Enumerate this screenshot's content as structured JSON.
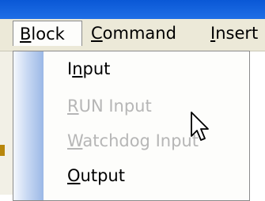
{
  "menubar": {
    "items": [
      {
        "label": "Block",
        "mnemonic": "B",
        "rest": "lock"
      },
      {
        "label": "Command",
        "mnemonic": "C",
        "rest": "ommand"
      },
      {
        "label": "Insert",
        "mnemonic": "I",
        "rest": "nsert"
      }
    ]
  },
  "dropdown": {
    "items": [
      {
        "label": "Input",
        "mnemonic": "n",
        "pre": "I",
        "post": "put",
        "enabled": true
      },
      {
        "label": "RUN Input",
        "mnemonic": "R",
        "pre": "",
        "post": "UN Input",
        "enabled": false
      },
      {
        "label": "Watchdog Input",
        "mnemonic": "W",
        "pre": "",
        "post": "atchdog Input",
        "enabled": false
      },
      {
        "label": "Output",
        "mnemonic": "O",
        "pre": "",
        "post": "utput",
        "enabled": true
      }
    ]
  },
  "colors": {
    "menubar_bg": "#ece9d8",
    "menu_bg": "#fdfdfb",
    "disabled_text": "#b6b6b6",
    "icon_column": "#9bb8e6"
  },
  "icons": {
    "cursor": "mouse-pointer-icon"
  }
}
